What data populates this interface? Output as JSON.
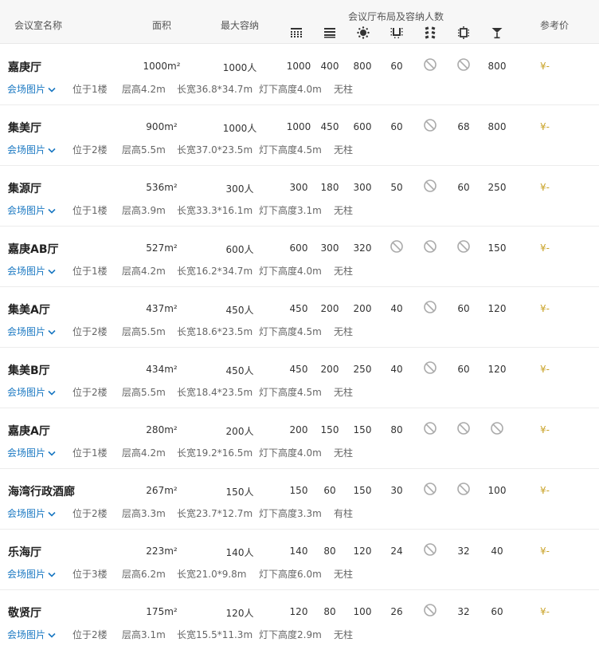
{
  "header": {
    "name": "会议室名称",
    "area": "面积",
    "capacity": "最大容纳",
    "layouts": "会议厅布局及容纳人数",
    "price": "参考价",
    "layout_icons": [
      "theater-layout-icon",
      "classroom-layout-icon",
      "banquet-layout-icon",
      "u-shape-layout-icon",
      "fishbone-layout-icon",
      "boardroom-layout-icon",
      "cocktail-layout-icon"
    ]
  },
  "photos_label": "会场图片",
  "rooms": [
    {
      "name": "嘉庚厅",
      "area": "1000m²",
      "capacity": "1000人",
      "layouts": [
        "1000",
        "400",
        "800",
        "60",
        "",
        "",
        "800"
      ],
      "price": "¥-",
      "floor": "位于1楼",
      "height": "层高4.2m",
      "dims": "长宽36.8*34.7m",
      "light": "灯下高度4.0m",
      "pillar": "无柱"
    },
    {
      "name": "集美厅",
      "area": "900m²",
      "capacity": "1000人",
      "layouts": [
        "1000",
        "450",
        "600",
        "60",
        "",
        "68",
        "800"
      ],
      "price": "¥-",
      "floor": "位于2楼",
      "height": "层高5.5m",
      "dims": "长宽37.0*23.5m",
      "light": "灯下高度4.5m",
      "pillar": "无柱"
    },
    {
      "name": "集源厅",
      "area": "536m²",
      "capacity": "300人",
      "layouts": [
        "300",
        "180",
        "300",
        "50",
        "",
        "60",
        "250"
      ],
      "price": "¥-",
      "floor": "位于1楼",
      "height": "层高3.9m",
      "dims": "长宽33.3*16.1m",
      "light": "灯下高度3.1m",
      "pillar": "无柱"
    },
    {
      "name": "嘉庚AB厅",
      "area": "527m²",
      "capacity": "600人",
      "layouts": [
        "600",
        "300",
        "320",
        "",
        "",
        "",
        "150"
      ],
      "price": "¥-",
      "floor": "位于1楼",
      "height": "层高4.2m",
      "dims": "长宽16.2*34.7m",
      "light": "灯下高度4.0m",
      "pillar": "无柱"
    },
    {
      "name": "集美A厅",
      "area": "437m²",
      "capacity": "450人",
      "layouts": [
        "450",
        "200",
        "200",
        "40",
        "",
        "60",
        "120"
      ],
      "price": "¥-",
      "floor": "位于2楼",
      "height": "层高5.5m",
      "dims": "长宽18.6*23.5m",
      "light": "灯下高度4.5m",
      "pillar": "无柱"
    },
    {
      "name": "集美B厅",
      "area": "434m²",
      "capacity": "450人",
      "layouts": [
        "450",
        "200",
        "250",
        "40",
        "",
        "60",
        "120"
      ],
      "price": "¥-",
      "floor": "位于2楼",
      "height": "层高5.5m",
      "dims": "长宽18.4*23.5m",
      "light": "灯下高度4.5m",
      "pillar": "无柱"
    },
    {
      "name": "嘉庚A厅",
      "area": "280m²",
      "capacity": "200人",
      "layouts": [
        "200",
        "150",
        "150",
        "80",
        "",
        "",
        ""
      ],
      "price": "¥-",
      "floor": "位于1楼",
      "height": "层高4.2m",
      "dims": "长宽19.2*16.5m",
      "light": "灯下高度4.0m",
      "pillar": "无柱"
    },
    {
      "name": "海湾行政酒廊",
      "area": "267m²",
      "capacity": "150人",
      "layouts": [
        "150",
        "60",
        "150",
        "30",
        "",
        "",
        "100"
      ],
      "price": "¥-",
      "floor": "位于2楼",
      "height": "层高3.3m",
      "dims": "长宽23.7*12.7m",
      "light": "灯下高度3.3m",
      "pillar": "有柱"
    },
    {
      "name": "乐海厅",
      "area": "223m²",
      "capacity": "140人",
      "layouts": [
        "140",
        "80",
        "120",
        "24",
        "",
        "32",
        "40"
      ],
      "price": "¥-",
      "floor": "位于3楼",
      "height": "层高6.2m",
      "dims": "长宽21.0*9.8m",
      "light": "灯下高度6.0m",
      "pillar": "无柱"
    },
    {
      "name": "敬贤厅",
      "area": "175m²",
      "capacity": "120人",
      "layouts": [
        "120",
        "80",
        "100",
        "26",
        "",
        "32",
        "60"
      ],
      "price": "¥-",
      "floor": "位于2楼",
      "height": "层高3.1m",
      "dims": "长宽15.5*11.3m",
      "light": "灯下高度2.9m",
      "pillar": "无柱"
    }
  ],
  "colors": {
    "link": "#1a78c2",
    "price": "#c9a227",
    "header_bg": "#f7f7f7"
  }
}
